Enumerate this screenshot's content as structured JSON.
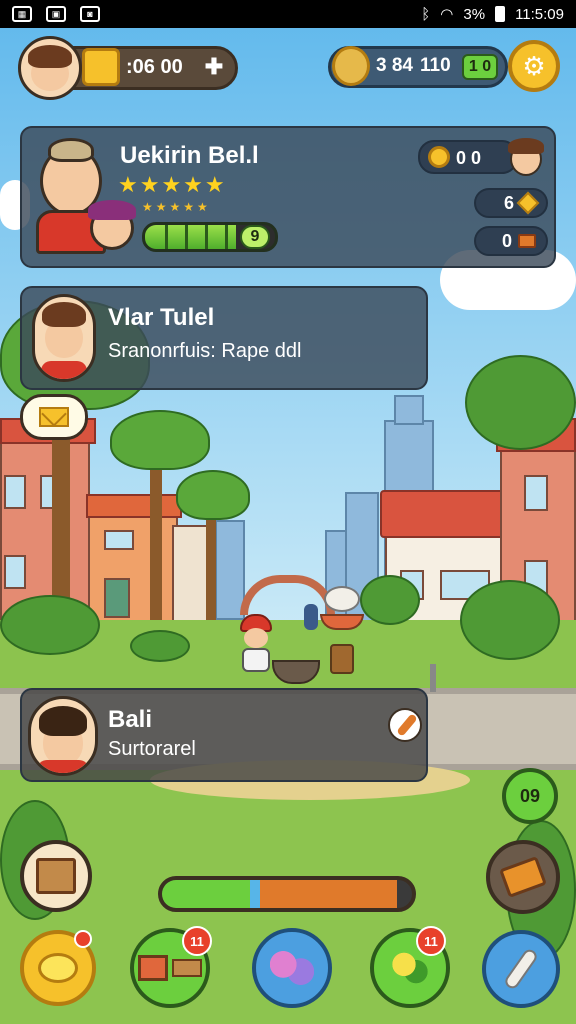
{
  "status_bar": {
    "time": "11:5:09",
    "battery": "3%",
    "left_icons": [
      "gallery-icon",
      "image-icon",
      "notification-icon"
    ],
    "right_icons": [
      "bluetooth-icon",
      "wifi-icon",
      "battery-icon"
    ]
  },
  "top_hud": {
    "currency_left": ":06 00",
    "currency_right_a": "3 84",
    "currency_right_b": "110",
    "currency_right_badge": "1 0"
  },
  "profile_card": {
    "name": "Uekirin Bel.l",
    "rating_stars": 5,
    "sub_stars": 5,
    "level_progress": 0.7,
    "level_badge": "9",
    "coins": "0 0",
    "stat_a": "6",
    "stat_b": "0"
  },
  "quest_card": {
    "title": "Vlar Tulel",
    "subtitle": "Sranonrfuis: Rape ddl"
  },
  "chat_card": {
    "title": "Bali",
    "subtitle": "Surtorarel"
  },
  "side_buttons": {
    "right_mid_label": "09"
  },
  "energy_bar": {
    "green_fraction": 0.35,
    "orange_fraction": 0.55
  },
  "bottom_bar": {
    "badges": [
      "",
      "11",
      "",
      "11",
      ""
    ]
  },
  "colors": {
    "hud_brown": "#5a4a3a",
    "coin_gold": "#f6c12b",
    "panel": "#3c4b5a",
    "alert_red": "#e8412b",
    "progress_green": "#6ccf3e"
  }
}
